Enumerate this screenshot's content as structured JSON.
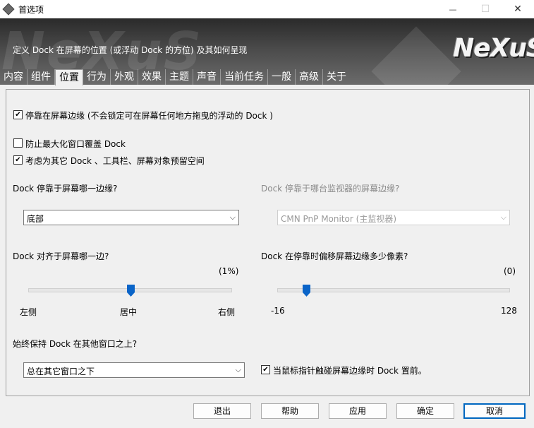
{
  "window": {
    "title": "首选项",
    "minimize_glyph": "—",
    "maximize_glyph": "☐",
    "close_glyph": "✕"
  },
  "banner": {
    "description": "定义 Dock 在屏幕的位置 (或浮动 Dock 的方位) 及其如何呈现",
    "logo_text": "NeXuS",
    "watermark_text": "NeXuS"
  },
  "tabs": [
    "内容",
    "组件",
    "位置",
    "行为",
    "外观",
    "效果",
    "主题",
    "声音",
    "当前任务",
    "一般",
    "高级",
    "关于"
  ],
  "active_tab": "位置",
  "position": {
    "pin_edge": {
      "label": "停靠在屏幕边缘 (不会锁定可在屏幕任何地方拖曳的浮动的 Dock )",
      "checked": true
    },
    "prevent_maximize": {
      "label": "防止最大化窗口覆盖 Dock",
      "checked": false
    },
    "reserve_space": {
      "label": "考虑为其它 Dock 、工具栏、屏幕对象预留空间",
      "checked": true
    },
    "edge_question": "Dock 停靠于屏幕哪一边缘?",
    "edge_value": "底部",
    "monitor_question": "Dock 停靠于哪台监视器的屏幕边缘?",
    "monitor_value": "CMN PnP Monitor (主监视器)",
    "align_question": "Dock 对齐于屏幕哪一边?",
    "align_readout": "(1%)",
    "align_level": 0.5,
    "align_labels": {
      "left": "左侧",
      "center": "居中",
      "right": "右侧"
    },
    "offset_question": "Dock 在停靠时偏移屏幕边缘多少像素?",
    "offset_readout": "(0)",
    "offset_value": 0,
    "offset_min": "-16",
    "offset_max": "128",
    "ontop_question": "始终保持 Dock 在其他窗口之上?",
    "ontop_value": "总在其它窗口之下",
    "bring_front": {
      "label": "当鼠标指针触碰屏幕边缘时 Dock 置前。",
      "checked": true
    }
  },
  "buttons": {
    "exit": "退出",
    "help": "帮助",
    "apply": "应用",
    "ok": "确定",
    "cancel": "取消"
  },
  "icons": {
    "check": "✔",
    "chevron": "⌵"
  },
  "colors": {
    "accent": "#0a64c8",
    "banner_top": "#2a2a2a",
    "banner_bottom": "#6b6b6b"
  }
}
